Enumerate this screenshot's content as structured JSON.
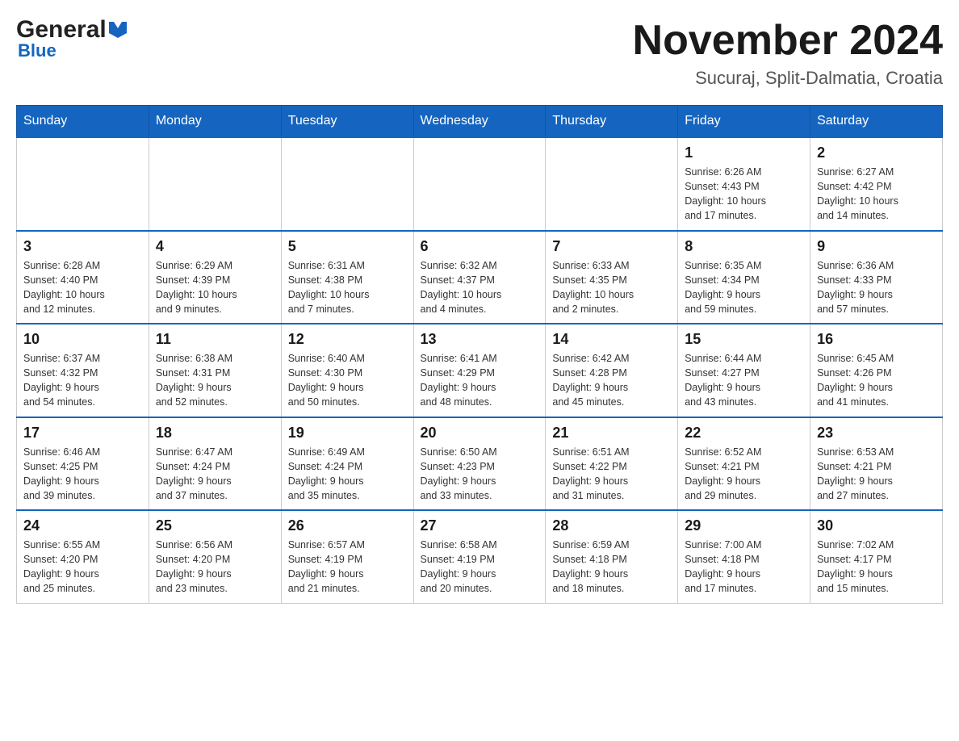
{
  "header": {
    "logo": {
      "general": "General",
      "blue": "Blue"
    },
    "title": "November 2024",
    "location": "Sucuraj, Split-Dalmatia, Croatia"
  },
  "days_of_week": [
    "Sunday",
    "Monday",
    "Tuesday",
    "Wednesday",
    "Thursday",
    "Friday",
    "Saturday"
  ],
  "weeks": [
    [
      {
        "day": "",
        "info": ""
      },
      {
        "day": "",
        "info": ""
      },
      {
        "day": "",
        "info": ""
      },
      {
        "day": "",
        "info": ""
      },
      {
        "day": "",
        "info": ""
      },
      {
        "day": "1",
        "info": "Sunrise: 6:26 AM\nSunset: 4:43 PM\nDaylight: 10 hours\nand 17 minutes."
      },
      {
        "day": "2",
        "info": "Sunrise: 6:27 AM\nSunset: 4:42 PM\nDaylight: 10 hours\nand 14 minutes."
      }
    ],
    [
      {
        "day": "3",
        "info": "Sunrise: 6:28 AM\nSunset: 4:40 PM\nDaylight: 10 hours\nand 12 minutes."
      },
      {
        "day": "4",
        "info": "Sunrise: 6:29 AM\nSunset: 4:39 PM\nDaylight: 10 hours\nand 9 minutes."
      },
      {
        "day": "5",
        "info": "Sunrise: 6:31 AM\nSunset: 4:38 PM\nDaylight: 10 hours\nand 7 minutes."
      },
      {
        "day": "6",
        "info": "Sunrise: 6:32 AM\nSunset: 4:37 PM\nDaylight: 10 hours\nand 4 minutes."
      },
      {
        "day": "7",
        "info": "Sunrise: 6:33 AM\nSunset: 4:35 PM\nDaylight: 10 hours\nand 2 minutes."
      },
      {
        "day": "8",
        "info": "Sunrise: 6:35 AM\nSunset: 4:34 PM\nDaylight: 9 hours\nand 59 minutes."
      },
      {
        "day": "9",
        "info": "Sunrise: 6:36 AM\nSunset: 4:33 PM\nDaylight: 9 hours\nand 57 minutes."
      }
    ],
    [
      {
        "day": "10",
        "info": "Sunrise: 6:37 AM\nSunset: 4:32 PM\nDaylight: 9 hours\nand 54 minutes."
      },
      {
        "day": "11",
        "info": "Sunrise: 6:38 AM\nSunset: 4:31 PM\nDaylight: 9 hours\nand 52 minutes."
      },
      {
        "day": "12",
        "info": "Sunrise: 6:40 AM\nSunset: 4:30 PM\nDaylight: 9 hours\nand 50 minutes."
      },
      {
        "day": "13",
        "info": "Sunrise: 6:41 AM\nSunset: 4:29 PM\nDaylight: 9 hours\nand 48 minutes."
      },
      {
        "day": "14",
        "info": "Sunrise: 6:42 AM\nSunset: 4:28 PM\nDaylight: 9 hours\nand 45 minutes."
      },
      {
        "day": "15",
        "info": "Sunrise: 6:44 AM\nSunset: 4:27 PM\nDaylight: 9 hours\nand 43 minutes."
      },
      {
        "day": "16",
        "info": "Sunrise: 6:45 AM\nSunset: 4:26 PM\nDaylight: 9 hours\nand 41 minutes."
      }
    ],
    [
      {
        "day": "17",
        "info": "Sunrise: 6:46 AM\nSunset: 4:25 PM\nDaylight: 9 hours\nand 39 minutes."
      },
      {
        "day": "18",
        "info": "Sunrise: 6:47 AM\nSunset: 4:24 PM\nDaylight: 9 hours\nand 37 minutes."
      },
      {
        "day": "19",
        "info": "Sunrise: 6:49 AM\nSunset: 4:24 PM\nDaylight: 9 hours\nand 35 minutes."
      },
      {
        "day": "20",
        "info": "Sunrise: 6:50 AM\nSunset: 4:23 PM\nDaylight: 9 hours\nand 33 minutes."
      },
      {
        "day": "21",
        "info": "Sunrise: 6:51 AM\nSunset: 4:22 PM\nDaylight: 9 hours\nand 31 minutes."
      },
      {
        "day": "22",
        "info": "Sunrise: 6:52 AM\nSunset: 4:21 PM\nDaylight: 9 hours\nand 29 minutes."
      },
      {
        "day": "23",
        "info": "Sunrise: 6:53 AM\nSunset: 4:21 PM\nDaylight: 9 hours\nand 27 minutes."
      }
    ],
    [
      {
        "day": "24",
        "info": "Sunrise: 6:55 AM\nSunset: 4:20 PM\nDaylight: 9 hours\nand 25 minutes."
      },
      {
        "day": "25",
        "info": "Sunrise: 6:56 AM\nSunset: 4:20 PM\nDaylight: 9 hours\nand 23 minutes."
      },
      {
        "day": "26",
        "info": "Sunrise: 6:57 AM\nSunset: 4:19 PM\nDaylight: 9 hours\nand 21 minutes."
      },
      {
        "day": "27",
        "info": "Sunrise: 6:58 AM\nSunset: 4:19 PM\nDaylight: 9 hours\nand 20 minutes."
      },
      {
        "day": "28",
        "info": "Sunrise: 6:59 AM\nSunset: 4:18 PM\nDaylight: 9 hours\nand 18 minutes."
      },
      {
        "day": "29",
        "info": "Sunrise: 7:00 AM\nSunset: 4:18 PM\nDaylight: 9 hours\nand 17 minutes."
      },
      {
        "day": "30",
        "info": "Sunrise: 7:02 AM\nSunset: 4:17 PM\nDaylight: 9 hours\nand 15 minutes."
      }
    ]
  ]
}
